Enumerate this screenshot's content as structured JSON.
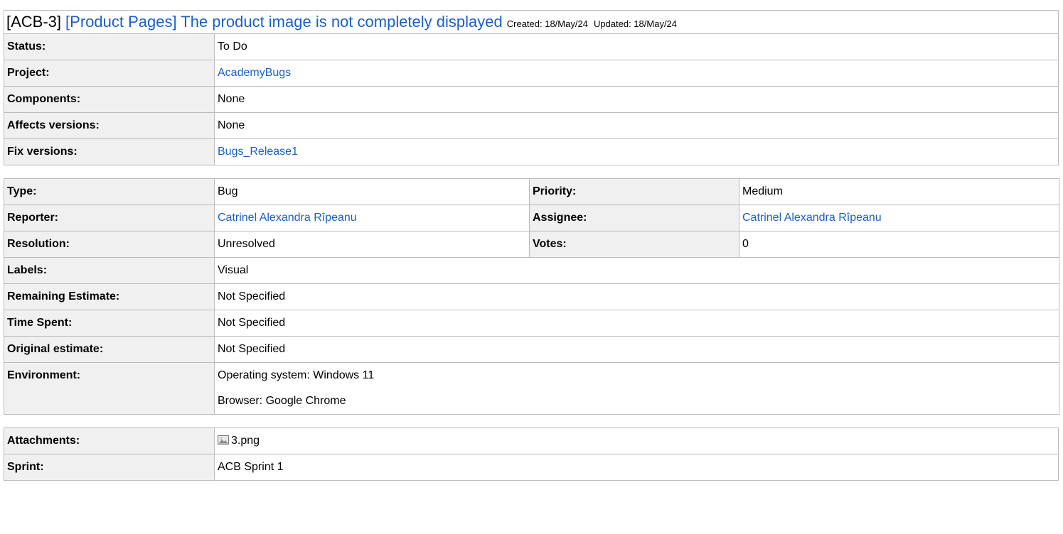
{
  "issue": {
    "key": "[ACB-3]",
    "summary": "[Product Pages] The product image is not completely displayed",
    "created": "Created: 18/May/24",
    "updated": "Updated: 18/May/24"
  },
  "details": {
    "status_label": "Status:",
    "status_value": "To Do",
    "project_label": "Project:",
    "project_value": "AcademyBugs",
    "components_label": "Components:",
    "components_value": "None",
    "affects_label": "Affects versions:",
    "affects_value": "None",
    "fix_label": "Fix versions:",
    "fix_value": "Bugs_Release1"
  },
  "people": {
    "type_label": "Type:",
    "type_value": "Bug",
    "priority_label": "Priority:",
    "priority_value": "Medium",
    "reporter_label": "Reporter:",
    "reporter_value": "Catrinel Alexandra Rîpeanu",
    "assignee_label": "Assignee:",
    "assignee_value": "Catrinel Alexandra Rîpeanu",
    "resolution_label": "Resolution:",
    "resolution_value": "Unresolved",
    "votes_label": "Votes:",
    "votes_value": "0",
    "labels_label": "Labels:",
    "labels_value": "Visual",
    "remaining_label": "Remaining Estimate:",
    "remaining_value": "Not Specified",
    "timespent_label": "Time Spent:",
    "timespent_value": "Not Specified",
    "original_label": "Original estimate:",
    "original_value": "Not Specified",
    "environment_label": "Environment:",
    "environment_lines": [
      "Operating system: Windows 11",
      "Browser: Google Chrome"
    ]
  },
  "extra": {
    "attachments_label": "Attachments:",
    "attachment_icon": "image-file-icon",
    "attachment_name": "3.png",
    "sprint_label": "Sprint:",
    "sprint_value": "ACB Sprint 1"
  },
  "colors": {
    "link": "#1a5fc8",
    "label_bg": "#f0f0f0",
    "border": "#bbbbbb"
  }
}
